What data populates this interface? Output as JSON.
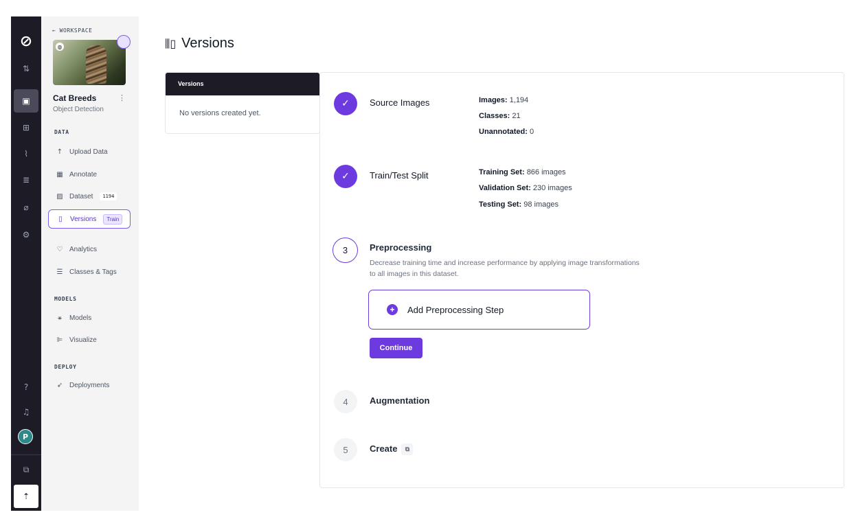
{
  "rail": {
    "logo": "⊘",
    "icons": [
      "⇅",
      "▣",
      "⊞",
      "⌇",
      "≣",
      "⌀",
      "⚙"
    ],
    "help": "?",
    "bell": "♫",
    "avatar": "P",
    "stack": "⧉",
    "upload": "⇡"
  },
  "sidebar": {
    "back_label": "← WORKSPACE",
    "project_name": "Cat Breeds",
    "project_menu": "⋮",
    "project_type": "Object Detection",
    "sections": {
      "data": "DATA",
      "models": "MODELS",
      "deploy": "DEPLOY"
    },
    "items": {
      "upload": "Upload Data",
      "annotate": "Annotate",
      "dataset": "Dataset",
      "dataset_count": "1194",
      "versions": "Versions",
      "versions_badge": "Train",
      "analytics": "Analytics",
      "classes": "Classes & Tags",
      "models": "Models",
      "visualize": "Visualize",
      "deployments": "Deployments"
    }
  },
  "page": {
    "title": "Versions"
  },
  "versions_panel": {
    "header": "Versions",
    "empty": "No versions created yet."
  },
  "steps": {
    "source": {
      "title": "Source Images",
      "images_label": "Images:",
      "images_value": "1,194",
      "classes_label": "Classes:",
      "classes_value": "21",
      "unannotated_label": "Unannotated:",
      "unannotated_value": "0"
    },
    "split": {
      "title": "Train/Test Split",
      "training_label": "Training Set:",
      "training_value": "866 images",
      "validation_label": "Validation Set:",
      "validation_value": "230 images",
      "testing_label": "Testing Set:",
      "testing_value": "98 images"
    },
    "preprocessing": {
      "number": "3",
      "title": "Preprocessing",
      "description": "Decrease training time and increase performance by applying image transformations to all images in this dataset.",
      "add_label": "Add Preprocessing Step",
      "continue_label": "Continue"
    },
    "augmentation": {
      "number": "4",
      "title": "Augmentation"
    },
    "create": {
      "number": "5",
      "title": "Create"
    }
  }
}
